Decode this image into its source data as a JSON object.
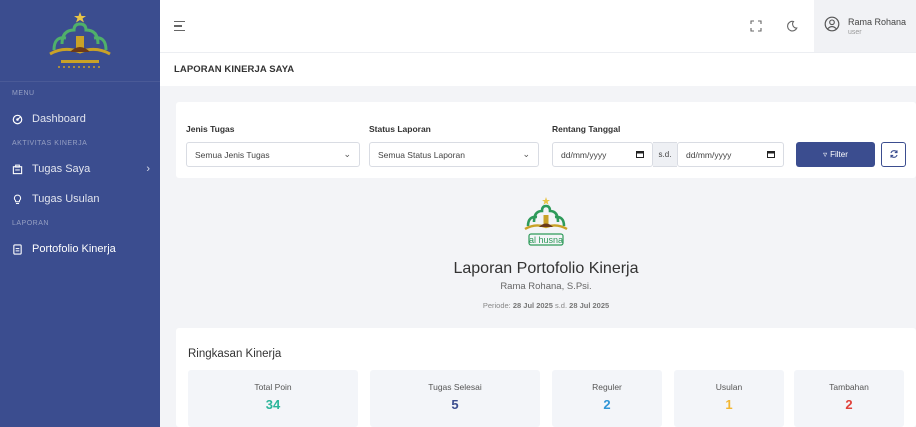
{
  "app": {
    "logo_text": "al husna",
    "sidebar_logo_caption": "YAYASAN AL HUSNA"
  },
  "sidebar": {
    "sections": {
      "menu": "MENU",
      "aktivitas": "AKTIVITAS KINERJA",
      "laporan": "LAPORAN"
    },
    "items": [
      {
        "label": "Dashboard",
        "icon": "dashboard-icon"
      },
      {
        "label": "Tugas Saya",
        "icon": "tasks-icon",
        "has_submenu": true
      },
      {
        "label": "Tugas Usulan",
        "icon": "lightbulb-icon"
      },
      {
        "label": "Portofolio Kinerja",
        "icon": "document-icon",
        "active": true
      }
    ],
    "submenu_caret": "›"
  },
  "topbar": {
    "user_name": "Rama Rohana",
    "user_role": "user",
    "icons": [
      "hamburger-icon",
      "fullscreen-icon",
      "dark-mode-icon",
      "user-icon"
    ]
  },
  "page": {
    "title": "LAPORAN KINERJA SAYA"
  },
  "filters": {
    "jenis_tugas_label": "Jenis Tugas",
    "jenis_tugas_value": "Semua Jenis Tugas",
    "status_label": "Status Laporan",
    "status_value": "Semua Status Laporan",
    "rentang_label": "Rentang Tanggal",
    "date_from_placeholder": "dd/mm/yyyy",
    "date_separator": "s.d.",
    "date_to_placeholder": "dd/mm/yyyy",
    "filter_button": "Filter",
    "filter_icon": "▿"
  },
  "report": {
    "title": "Laporan Portofolio Kinerja",
    "name": "Rama Rohana, S.Psi.",
    "period_prefix": "Periode:",
    "period_from": "28 Jul 2025",
    "period_sep": "s.d.",
    "period_to": "28 Jul 2025"
  },
  "summary": {
    "title": "Ringkasan Kinerja",
    "stats": [
      {
        "label": "Total Poin",
        "value": "34",
        "color": "#2bb59a"
      },
      {
        "label": "Tugas Selesai",
        "value": "5",
        "color": "#3b4d8f"
      },
      {
        "label": "Reguler",
        "value": "2",
        "color": "#2f95d6"
      },
      {
        "label": "Usulan",
        "value": "1",
        "color": "#f2b632"
      },
      {
        "label": "Tambahan",
        "value": "2",
        "color": "#e0413a"
      }
    ]
  },
  "colors": {
    "sidebar_bg": "#3b4d8f",
    "primary": "#3b4d8f",
    "logo_green": "#2e9a5a",
    "logo_gold": "#c9a227"
  }
}
